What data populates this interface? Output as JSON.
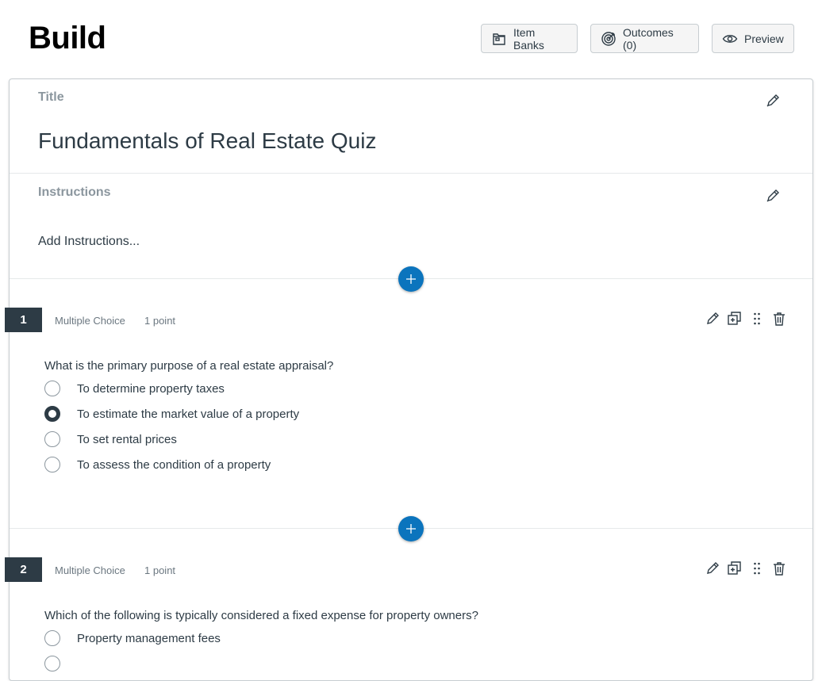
{
  "header": {
    "title": "Build",
    "buttons": {
      "item_banks": "Item Banks",
      "outcomes": "Outcomes (0)",
      "preview": "Preview"
    }
  },
  "quiz": {
    "title_label": "Title",
    "title": "Fundamentals of Real Estate Quiz",
    "instructions_label": "Instructions",
    "instructions_placeholder": "Add Instructions..."
  },
  "questions": [
    {
      "number": "1",
      "type": "Multiple Choice",
      "points": "1 point",
      "text": "What is the primary purpose of a real estate appraisal?",
      "answers": [
        "To determine property taxes",
        "To estimate the market value of a property",
        "To set rental prices",
        "To assess the condition of a property"
      ],
      "correct_index": 1
    },
    {
      "number": "2",
      "type": "Multiple Choice",
      "points": "1 point",
      "text": "Which of the following is typically considered a fixed expense for property owners?",
      "answers": [
        "Property management fees"
      ],
      "correct_index": -1
    }
  ],
  "icons": {
    "item_banks": "item-banks-icon",
    "outcomes": "target-icon",
    "preview": "eye-icon",
    "edit": "pencil-icon",
    "add": "plus-icon",
    "duplicate": "duplicate-icon",
    "drag": "drag-handle-icon",
    "delete": "trash-icon"
  },
  "colors": {
    "accent": "#0b74bd",
    "question_badge": "#2d3b45",
    "label_gray": "#8b969e"
  }
}
